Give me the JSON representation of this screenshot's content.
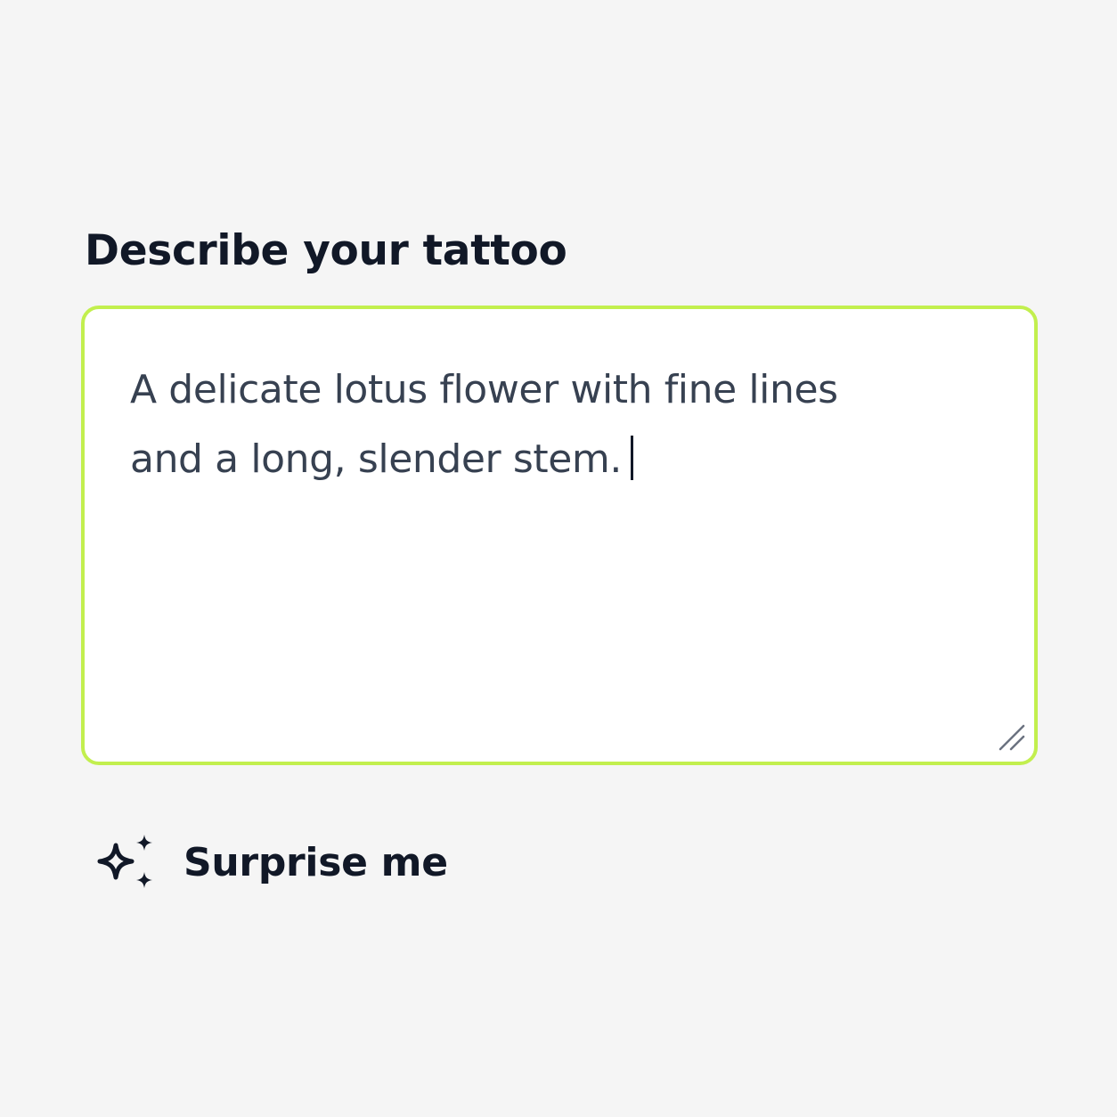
{
  "form": {
    "label": "Describe your tattoo",
    "textarea": {
      "value_line1": "A delicate lotus flower with fine lines",
      "value_line2": "and a long, slender stem.",
      "border_color": "#c2ef4e",
      "state": "focused"
    },
    "resize_icon": "resize-grip-icon"
  },
  "surprise": {
    "label": "Surprise me",
    "icon": "sparkles-icon"
  }
}
